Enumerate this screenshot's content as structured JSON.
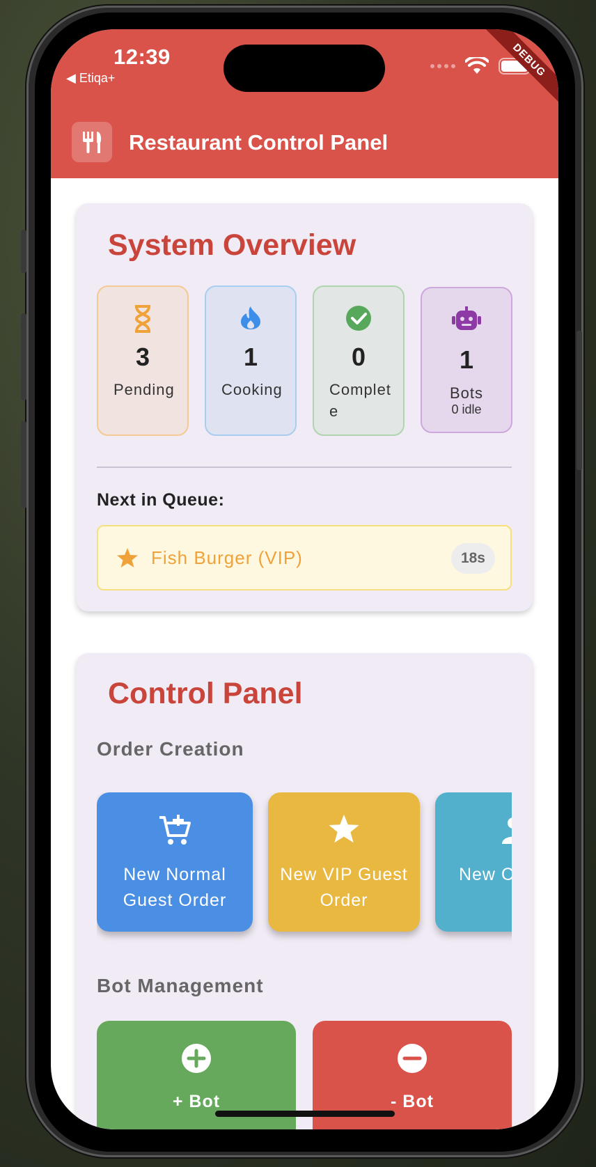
{
  "status_bar": {
    "time": "12:39",
    "back_app": "◀ Etiqa+",
    "debug_banner": "DEBUG"
  },
  "app_bar": {
    "title": "Restaurant Control Panel",
    "icon": "fork-knife-icon",
    "color": "#d9534a"
  },
  "overview": {
    "title": "System Overview",
    "stats": [
      {
        "icon": "hourglass-icon",
        "value": "3",
        "label": "Pending",
        "color": "#f0a23a"
      },
      {
        "icon": "fire-icon",
        "value": "1",
        "label": "Cooking",
        "color": "#3d8ee8"
      },
      {
        "icon": "check-circle-icon",
        "value": "0",
        "label": "Complete",
        "color": "#58a85c"
      },
      {
        "icon": "robot-icon",
        "value": "1",
        "label": "Bots",
        "sub": "0 idle",
        "color": "#8e3aa6"
      }
    ],
    "queue_label": "Next in Queue:",
    "queue_item": {
      "icon": "star-icon",
      "name": "Fish Burger (VIP)",
      "timer": "18s"
    }
  },
  "control_panel": {
    "title": "Control Panel",
    "order_section": "Order Creation",
    "order_buttons": [
      {
        "icon": "add-cart-icon",
        "label": "New Normal Guest Order",
        "color": "#4a8fe3"
      },
      {
        "icon": "star-icon",
        "label": "New VIP Guest Order",
        "color": "#e8b841"
      },
      {
        "icon": "add-person-icon",
        "label": "New C... O...",
        "color": "#52b0cd"
      }
    ],
    "bot_section": "Bot Management",
    "bot_buttons": [
      {
        "icon": "plus-circle-icon",
        "label": "+ Bot",
        "color": "#66a95d"
      },
      {
        "icon": "minus-circle-icon",
        "label": "- Bot",
        "color": "#d9534a"
      }
    ]
  }
}
